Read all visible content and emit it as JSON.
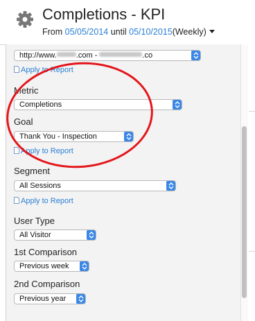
{
  "header": {
    "title": "Completions - KPI",
    "range_prefix": "From",
    "start_date": "05/05/2014",
    "range_mid": "until",
    "end_date": "05/10/2015",
    "granularity": "(Weekly)"
  },
  "site_select": {
    "value_prefix": "http://www.",
    "value_mid": ".com - ",
    "value_suffix": ".co"
  },
  "apply_label": "Apply to Report",
  "metric": {
    "label": "Metric",
    "value": "Completions"
  },
  "goal": {
    "label": "Goal",
    "value": "Thank You - Inspection"
  },
  "segment": {
    "label": "Segment",
    "value": "All Sessions"
  },
  "user_type": {
    "label": "User Type",
    "value": "All Visitor"
  },
  "comparison1": {
    "label": "1st Comparison",
    "value": "Previous week"
  },
  "comparison2": {
    "label": "2nd Comparison",
    "value": "Previous year"
  },
  "colors": {
    "accent": "#3b87e6",
    "link": "#2a7fd4",
    "annotation": "#e3161b"
  },
  "icons": {
    "gear": "gear-icon",
    "doc": "document-icon",
    "stepper": "chevron-updown-icon"
  }
}
